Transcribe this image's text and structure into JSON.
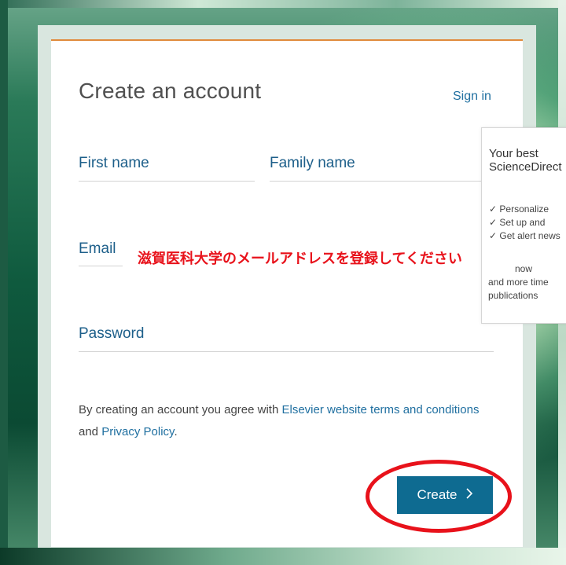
{
  "form": {
    "title": "Create an account",
    "signin_label": "Sign in",
    "first_name_label": "First name",
    "family_name_label": "Family name",
    "email_label": "Email",
    "password_label": "Password",
    "terms_prefix": "By creating an account you agree with ",
    "terms_link": "Elsevier website terms and conditions",
    "terms_and": " and ",
    "privacy_link": "Privacy Policy",
    "terms_suffix": ".",
    "create_label": "Create",
    "create_icon": "chevron-right-icon"
  },
  "annotation": {
    "text": "滋賀医科大学のメールアドレスを登録してください",
    "color": "#e8121b"
  },
  "promo": {
    "title_line1": "Your best",
    "title_line2": "ScienceDirect",
    "items": [
      "✓ Personalize",
      "✓ Set up and",
      "✓ Get alert news"
    ],
    "para_line1": "now",
    "para_line2": "and more time",
    "para_line3": "publications"
  },
  "colors": {
    "accent": "#e08a3c",
    "link": "#1f6fa0",
    "button": "#0e6b91"
  }
}
